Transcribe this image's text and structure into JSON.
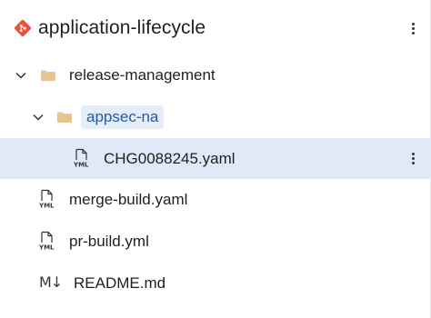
{
  "repo": {
    "title": "application-lifecycle",
    "icon": "git-repo-icon",
    "brand_color": "#e8533f"
  },
  "tree": {
    "folder1": {
      "label": "release-management",
      "expanded": true
    },
    "folder2": {
      "label": "appsec-na",
      "expanded": true
    },
    "file_selected": {
      "label": "CHG0088245.yaml",
      "icon_text": "YML"
    },
    "file_merge": {
      "label": "merge-build.yaml",
      "icon_text": "YML"
    },
    "file_pr": {
      "label": "pr-build.yml",
      "icon_text": "YML"
    },
    "file_readme": {
      "label": "README.md",
      "icon_text": "M↓"
    }
  },
  "colors": {
    "selected_row_bg": "#dfe9f7",
    "folder_color": "#e7c592",
    "highlight_text": "#1d5ea8"
  }
}
